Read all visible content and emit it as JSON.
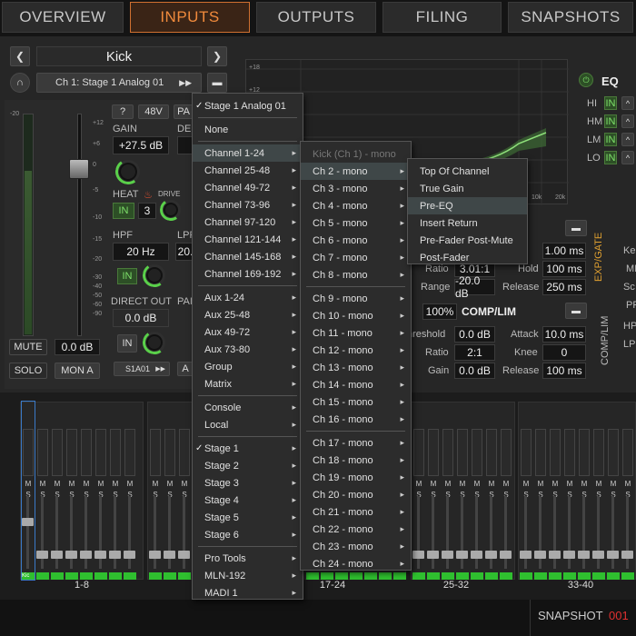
{
  "tabs": [
    "OVERVIEW",
    "INPUTS",
    "OUTPUTS",
    "FILING",
    "SNAPSHOTS"
  ],
  "active_tab": "INPUTS",
  "channel": {
    "name": "Kick",
    "source": "Ch 1: Stage 1 Analog 01",
    "gain_label": "GAIN",
    "gain_value": "+27.5 dB",
    "badge_48v": "48V",
    "badge_pad": "PA",
    "help": "?",
    "delay_label": "DE",
    "heat_label": "HEAT",
    "drive_label": "DRIVE",
    "heat_in": "IN",
    "heat_value": "3",
    "hpf_label": "HPF",
    "hpf_value": "20 Hz",
    "hpf_in": "IN",
    "lpf_label": "LPF",
    "lpf_value": "20.",
    "direct_out_label": "DIRECT OUT",
    "direct_out_value": "0.0 dB",
    "direct_in": "IN",
    "pan_label": "PAI",
    "assign": "S1A01",
    "mute": "MUTE",
    "fader_value": "0.0 dB",
    "solo": "SOLO",
    "mon": "MON A",
    "a_btn": "A",
    "fader_scale": [
      "+12",
      "+6",
      "0",
      "-5",
      "-10",
      "-15",
      "-20",
      "-30",
      "-40",
      "-50",
      "-60",
      "-90"
    ],
    "meter_scale": [
      "-20",
      "0"
    ]
  },
  "eq": {
    "title": "EQ",
    "bands": [
      {
        "name": "HI",
        "state": "IN"
      },
      {
        "name": "HM",
        "state": "IN"
      },
      {
        "name": "LM",
        "state": "IN"
      },
      {
        "name": "LO",
        "state": "IN"
      }
    ],
    "y_ticks": [
      "+18",
      "+12",
      "+6",
      "0",
      "-6",
      "-12",
      "-18"
    ],
    "x_ticks": [
      "10k",
      "20k"
    ]
  },
  "expgate": {
    "title": "EXP/GATE",
    "ratio_label": "Ratio",
    "ratio_value": "3.01:1",
    "range_label": "Range",
    "range_value": "-20.0 dB",
    "attack_partial": "ck",
    "attack_value": "1.00 ms",
    "hold_label": "Hold",
    "hold_value": "100 ms",
    "release_label": "Release",
    "release_value": "250 ms"
  },
  "complim": {
    "title": "COMP/LIM",
    "side_title": "COMP/LIM",
    "mix_value": "100%",
    "threshold_label": "hreshold",
    "threshold_value": "0.0 dB",
    "ratio_label": "Ratio",
    "ratio_value": "2:1",
    "gain_label": "Gain",
    "gain_value": "0.0 dB",
    "attack_label": "Attack",
    "attack_value": "10.0 ms",
    "knee_label": "Knee",
    "knee_value": "0",
    "release_label": "Release",
    "release_value": "100 ms"
  },
  "right_edge": {
    "ke": "Ke",
    "mi": "MI",
    "sc": "Sc",
    "pr": "PF",
    "hp": "HP",
    "lp": "LP"
  },
  "mixer": {
    "bank_labels": [
      "1-8",
      "17-24",
      "25-32",
      "33-40"
    ],
    "strip_ms": [
      "M",
      "S"
    ],
    "kick_tag": "Kic"
  },
  "bottom": {
    "snapshot_label": "SNAPSHOT",
    "snapshot_number": "001"
  },
  "menu1": {
    "items": [
      {
        "label": "Stage 1 Analog 01",
        "checked": true
      },
      {
        "label": "None"
      },
      {
        "label": "Channel 1-24",
        "arrow": true,
        "selected": true
      },
      {
        "label": "Channel 25-48",
        "arrow": true
      },
      {
        "label": "Channel 49-72",
        "arrow": true
      },
      {
        "label": "Channel 73-96",
        "arrow": true
      },
      {
        "label": "Channel 97-120",
        "arrow": true
      },
      {
        "label": "Channel 121-144",
        "arrow": true
      },
      {
        "label": "Channel 145-168",
        "arrow": true
      },
      {
        "label": "Channel 169-192",
        "arrow": true
      },
      {
        "label": "Aux 1-24",
        "arrow": true
      },
      {
        "label": "Aux 25-48",
        "arrow": true
      },
      {
        "label": "Aux 49-72",
        "arrow": true
      },
      {
        "label": "Aux 73-80",
        "arrow": true
      },
      {
        "label": "Group",
        "arrow": true
      },
      {
        "label": "Matrix",
        "arrow": true
      },
      {
        "label": "Console",
        "arrow": true
      },
      {
        "label": "Local",
        "arrow": true
      },
      {
        "label": "Stage 1",
        "arrow": true,
        "checked": true
      },
      {
        "label": "Stage 2",
        "arrow": true
      },
      {
        "label": "Stage 3",
        "arrow": true
      },
      {
        "label": "Stage 4",
        "arrow": true
      },
      {
        "label": "Stage 5",
        "arrow": true
      },
      {
        "label": "Stage 6",
        "arrow": true
      },
      {
        "label": "Pro Tools",
        "arrow": true
      },
      {
        "label": "MLN-192",
        "arrow": true
      },
      {
        "label": "MADI 1",
        "arrow": true
      }
    ]
  },
  "menu2": {
    "items": [
      {
        "label": "Kick (Ch 1) - mono",
        "dim": true
      },
      {
        "label": "Ch 2 - mono",
        "arrow": true,
        "selected": true
      },
      {
        "label": "Ch 3 - mono",
        "arrow": true
      },
      {
        "label": "Ch 4 - mono",
        "arrow": true
      },
      {
        "label": "Ch 5 - mono",
        "arrow": true
      },
      {
        "label": "Ch 6 - mono",
        "arrow": true
      },
      {
        "label": "Ch 7 - mono",
        "arrow": true
      },
      {
        "label": "Ch 8 - mono",
        "arrow": true
      },
      {
        "label": "Ch 9 - mono",
        "arrow": true
      },
      {
        "label": "Ch 10 - mono",
        "arrow": true
      },
      {
        "label": "Ch 11 - mono",
        "arrow": true
      },
      {
        "label": "Ch 12 - mono",
        "arrow": true
      },
      {
        "label": "Ch 13 - mono",
        "arrow": true
      },
      {
        "label": "Ch 14 - mono",
        "arrow": true
      },
      {
        "label": "Ch 15 - mono",
        "arrow": true
      },
      {
        "label": "Ch 16 - mono",
        "arrow": true
      },
      {
        "label": "Ch 17 - mono",
        "arrow": true
      },
      {
        "label": "Ch 18 - mono",
        "arrow": true
      },
      {
        "label": "Ch 19 - mono",
        "arrow": true
      },
      {
        "label": "Ch 20 - mono",
        "arrow": true
      },
      {
        "label": "Ch 21 - mono",
        "arrow": true
      },
      {
        "label": "Ch 22 - mono",
        "arrow": true
      },
      {
        "label": "Ch 23 - mono",
        "arrow": true
      },
      {
        "label": "Ch 24 - mono",
        "arrow": true
      }
    ]
  },
  "menu3": {
    "items": [
      {
        "label": "Top Of Channel"
      },
      {
        "label": "True Gain"
      },
      {
        "label": "Pre-EQ",
        "selected": true
      },
      {
        "label": "Insert Return"
      },
      {
        "label": "Pre-Fader Post-Mute"
      },
      {
        "label": "Post-Fader"
      }
    ]
  }
}
